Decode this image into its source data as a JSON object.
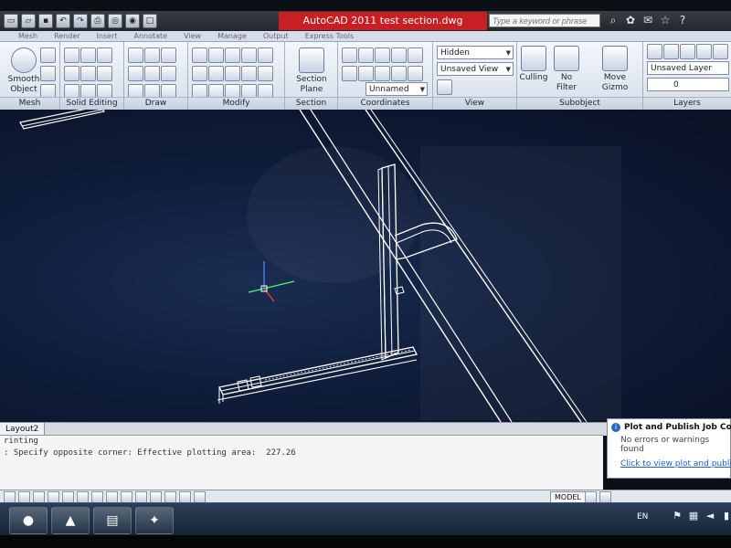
{
  "app": {
    "title": "AutoCAD 2011    test section.dwg",
    "search_placeholder": "Type a keyword or phrase"
  },
  "menu": [
    "Mesh",
    "Render",
    "Insert",
    "Annotate",
    "View",
    "Manage",
    "Output",
    "Express Tools"
  ],
  "ribbon": {
    "panels": {
      "mesh": "Mesh",
      "solid_editing": "Solid Editing",
      "draw": "Draw",
      "modify": "Modify",
      "section": "Section",
      "coordinates": "Coordinates",
      "view": "View",
      "subobject": "Subobject",
      "layers": "Layers"
    },
    "smooth_object": "Smooth Object",
    "section_plane": "Section Plane",
    "visual_style": "Hidden",
    "saved_view": "Unsaved View",
    "ucs": "Unnamed",
    "culling": "Culling",
    "no_filter": "No Filter",
    "move_gizmo": "Move Gizmo",
    "layer_state": "Unsaved Layer State",
    "layer_name": "0"
  },
  "tabs": {
    "layout": "Layout2"
  },
  "command_line": {
    "line1": "rinting",
    "line2": ": Specify opposite corner: Effective plotting area:  227.26"
  },
  "notification": {
    "title": "Plot and Publish Job Complete",
    "message": "No errors or warnings found",
    "link": "Click to view plot and publish details"
  },
  "status": {
    "model": "MODEL"
  },
  "taskbar": {
    "language": "EN"
  },
  "colors": {
    "title_accent": "#c81e24",
    "viewport_bg": "#10203f",
    "drawing_line": "#ffffff",
    "ucs_x": "#ff3b3b",
    "ucs_y": "#3cff66",
    "ucs_z": "#5c7cff"
  },
  "icons": [
    "new-icon",
    "open-icon",
    "save-icon",
    "undo-icon",
    "redo-icon",
    "plot-icon",
    "search-icon",
    "info-icon",
    "star-icon",
    "help-icon",
    "firefox-icon",
    "acrobat-icon",
    "document-icon",
    "messenger-icon"
  ]
}
